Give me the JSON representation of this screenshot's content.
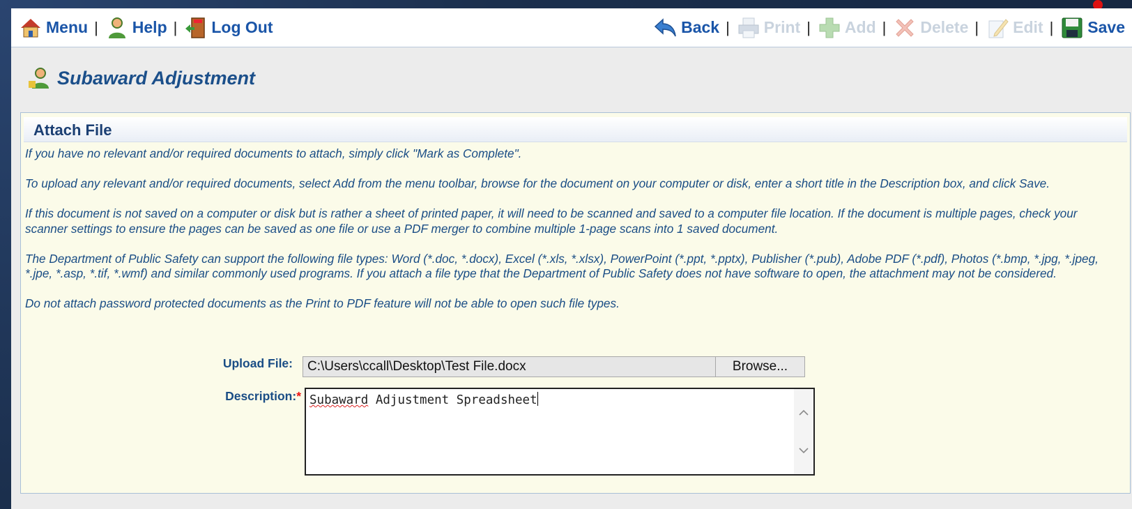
{
  "toolbar": {
    "menu": "Menu",
    "help": "Help",
    "logout": "Log Out",
    "back": "Back",
    "print": "Print",
    "add": "Add",
    "delete": "Delete",
    "edit": "Edit",
    "save": "Save",
    "separator": "|"
  },
  "page": {
    "title": "Subaward Adjustment"
  },
  "panel": {
    "heading": "Attach File",
    "instructions": [
      "If you have no relevant and/or required documents to attach, simply click \"Mark as Complete\".",
      "To upload any relevant and/or required documents, select Add from the menu toolbar, browse for the document on your computer or disk, enter a short title in the Description box, and click Save.",
      "If this document is not saved on a computer or disk but is rather a sheet of printed paper, it will need to be scanned and saved to a computer file location. If the document is multiple pages, check your scanner settings to ensure the pages can be saved as one file or use a PDF merger to combine multiple 1-page scans into 1 saved document.",
      "The Department of Public Safety can support the following file types: Word (*.doc, *.docx), Excel (*.xls, *.xlsx), PowerPoint (*.ppt, *.pptx), Publisher (*.pub), Adobe PDF (*.pdf), Photos (*.bmp, *.jpg, *.jpeg, *.jpe, *.asp, *.tif, *.wmf) and similar commonly used programs. If you attach a file type that the Department of Public Safety does not have software to open, the attachment may not be considered.",
      "Do not attach password protected documents as the Print to PDF feature will not be able to open such file types."
    ],
    "upload_label": "Upload File:",
    "upload_value": "C:\\Users\\ccall\\Desktop\\Test File.docx",
    "browse_label": "Browse...",
    "description_label": "Description:",
    "required_mark": "*",
    "description_word1": "Subaward",
    "description_rest": " Adjustment Spreadsheet"
  },
  "icons": [
    "home-icon",
    "help-person-icon",
    "exit-door-icon",
    "back-arrow-icon",
    "printer-icon",
    "plus-icon",
    "x-delete-icon",
    "edit-pencil-icon",
    "floppy-save-icon",
    "person-title-icon",
    "chevron-up-icon",
    "chevron-down-icon"
  ],
  "colors": {
    "accent": "#1a55a8",
    "disabled": "#c9d3de",
    "instruction_text": "#1a4d85",
    "panel_bg": "#fbfbe9",
    "required": "#e11111"
  }
}
